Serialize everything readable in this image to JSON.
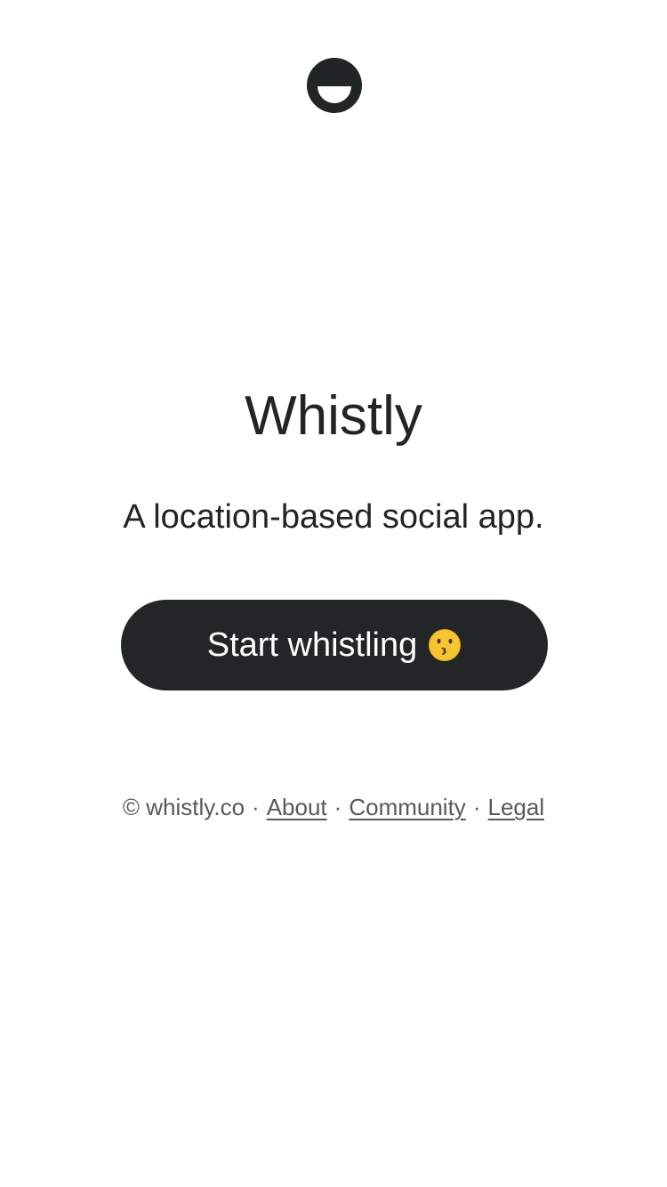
{
  "app": {
    "name": "Whistly",
    "tagline": "A location-based social app.",
    "logo_icon": "smiley-face-logo-icon"
  },
  "cta": {
    "label": "Start whistling",
    "emoji_icon": "kissing-face-emoji-icon"
  },
  "footer": {
    "copyright": "© whistly.co",
    "separator": "·",
    "links": [
      {
        "label": "About"
      },
      {
        "label": "Community"
      },
      {
        "label": "Legal"
      }
    ]
  },
  "colors": {
    "text": "#222525",
    "button_bg": "#232626",
    "button_text": "#ffffff",
    "footer_text": "#555a5a",
    "background": "#ffffff"
  }
}
